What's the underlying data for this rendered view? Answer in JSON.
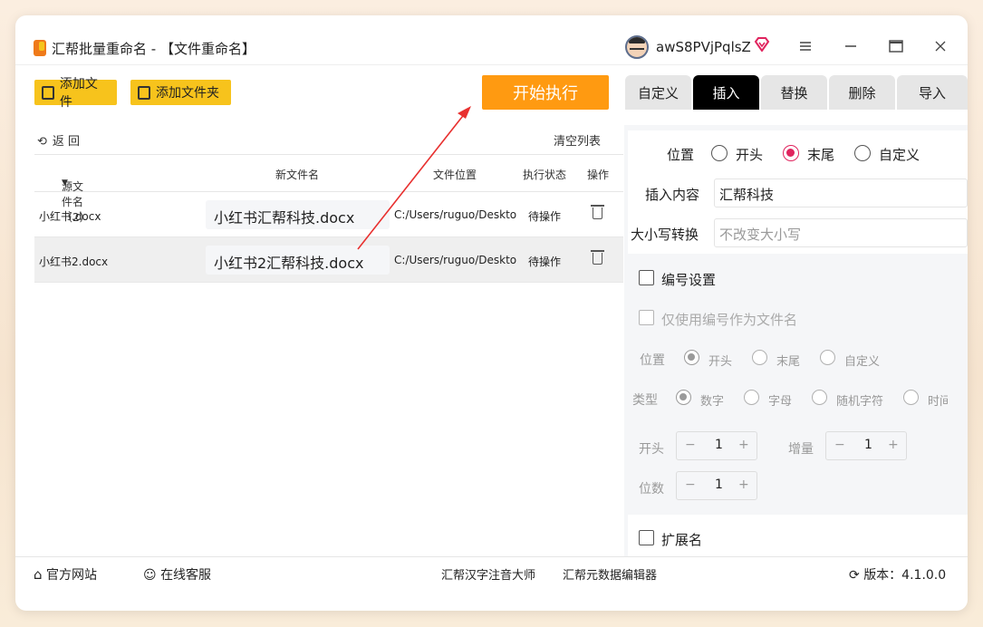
{
  "window": {
    "title": "汇帮批量重命名 - 【文件重命名】",
    "username": "awS8PVjPqlsZ"
  },
  "toolbar": {
    "add_file": "添加文件",
    "add_folder": "添加文件夹",
    "start": "开始执行"
  },
  "list": {
    "back": "返 回",
    "clear": "清空列表",
    "headers": {
      "source": "源文件名（2）",
      "new": "新文件名",
      "location": "文件位置",
      "status": "执行状态",
      "action": "操作"
    },
    "rows": [
      {
        "source": "小红书.docx",
        "new": "小红书汇帮科技.docx",
        "location": "C:/Users/ruguo/Deskto",
        "status": "待操作"
      },
      {
        "source": "小红书2.docx",
        "new": "小红书2汇帮科技.docx",
        "location": "C:/Users/ruguo/Deskto",
        "status": "待操作"
      }
    ]
  },
  "tabs": [
    "自定义",
    "插入",
    "替换",
    "删除",
    "导入"
  ],
  "insert": {
    "position_label": "位置",
    "positions": [
      "开头",
      "末尾",
      "自定义"
    ],
    "selected_position": "末尾",
    "content_label": "插入内容",
    "content_value": "汇帮科技",
    "case_label": "大小写转换",
    "case_placeholder": "不改变大小写"
  },
  "numbering": {
    "label": "编号设置",
    "only_number": "仅使用编号作为文件名",
    "position_label": "位置",
    "positions": [
      "开头",
      "末尾",
      "自定义"
    ],
    "type_label": "类型",
    "types": [
      "数字",
      "字母",
      "随机字符",
      "时间"
    ],
    "start_label": "开头",
    "start_value": "1",
    "increment_label": "增量",
    "increment_value": "1",
    "digits_label": "位数",
    "digits_value": "1"
  },
  "extension": {
    "label": "扩展名"
  },
  "footer": {
    "website": "官方网站",
    "service": "在线客服",
    "link1": "汇帮汉字注音大师",
    "link2": "汇帮元数据编辑器",
    "version": "版本：4.1.0.0"
  },
  "colors": {
    "accent": "#ff9a11",
    "yellow": "#f7c31c",
    "radio": "#e0245e",
    "arrow": "#e8302f"
  }
}
